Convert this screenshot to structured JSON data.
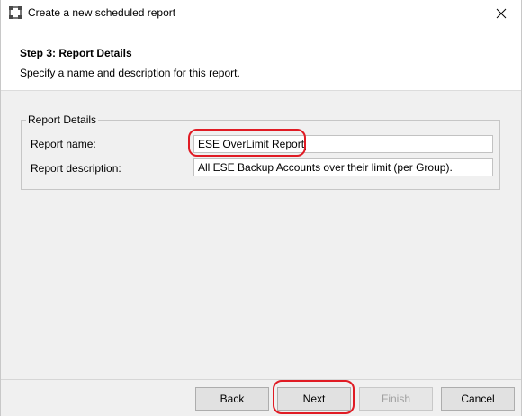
{
  "window": {
    "title": "Create a new scheduled report"
  },
  "header": {
    "step_title": "Step 3: Report Details",
    "step_subtitle": "Specify a name and description for this report."
  },
  "report_details": {
    "legend": "Report Details",
    "name_label": "Report name:",
    "name_value": "ESE OverLimit Report",
    "description_label": "Report description:",
    "description_value": "All ESE Backup Accounts over their limit (per Group)."
  },
  "footer": {
    "back_label": "Back",
    "next_label": "Next",
    "finish_label": "Finish",
    "cancel_label": "Cancel"
  },
  "colors": {
    "annotation_red": "#e01b24",
    "dialog_background": "#f0f0f0"
  },
  "icons": {
    "app": "app-icon",
    "close": "close-icon"
  }
}
